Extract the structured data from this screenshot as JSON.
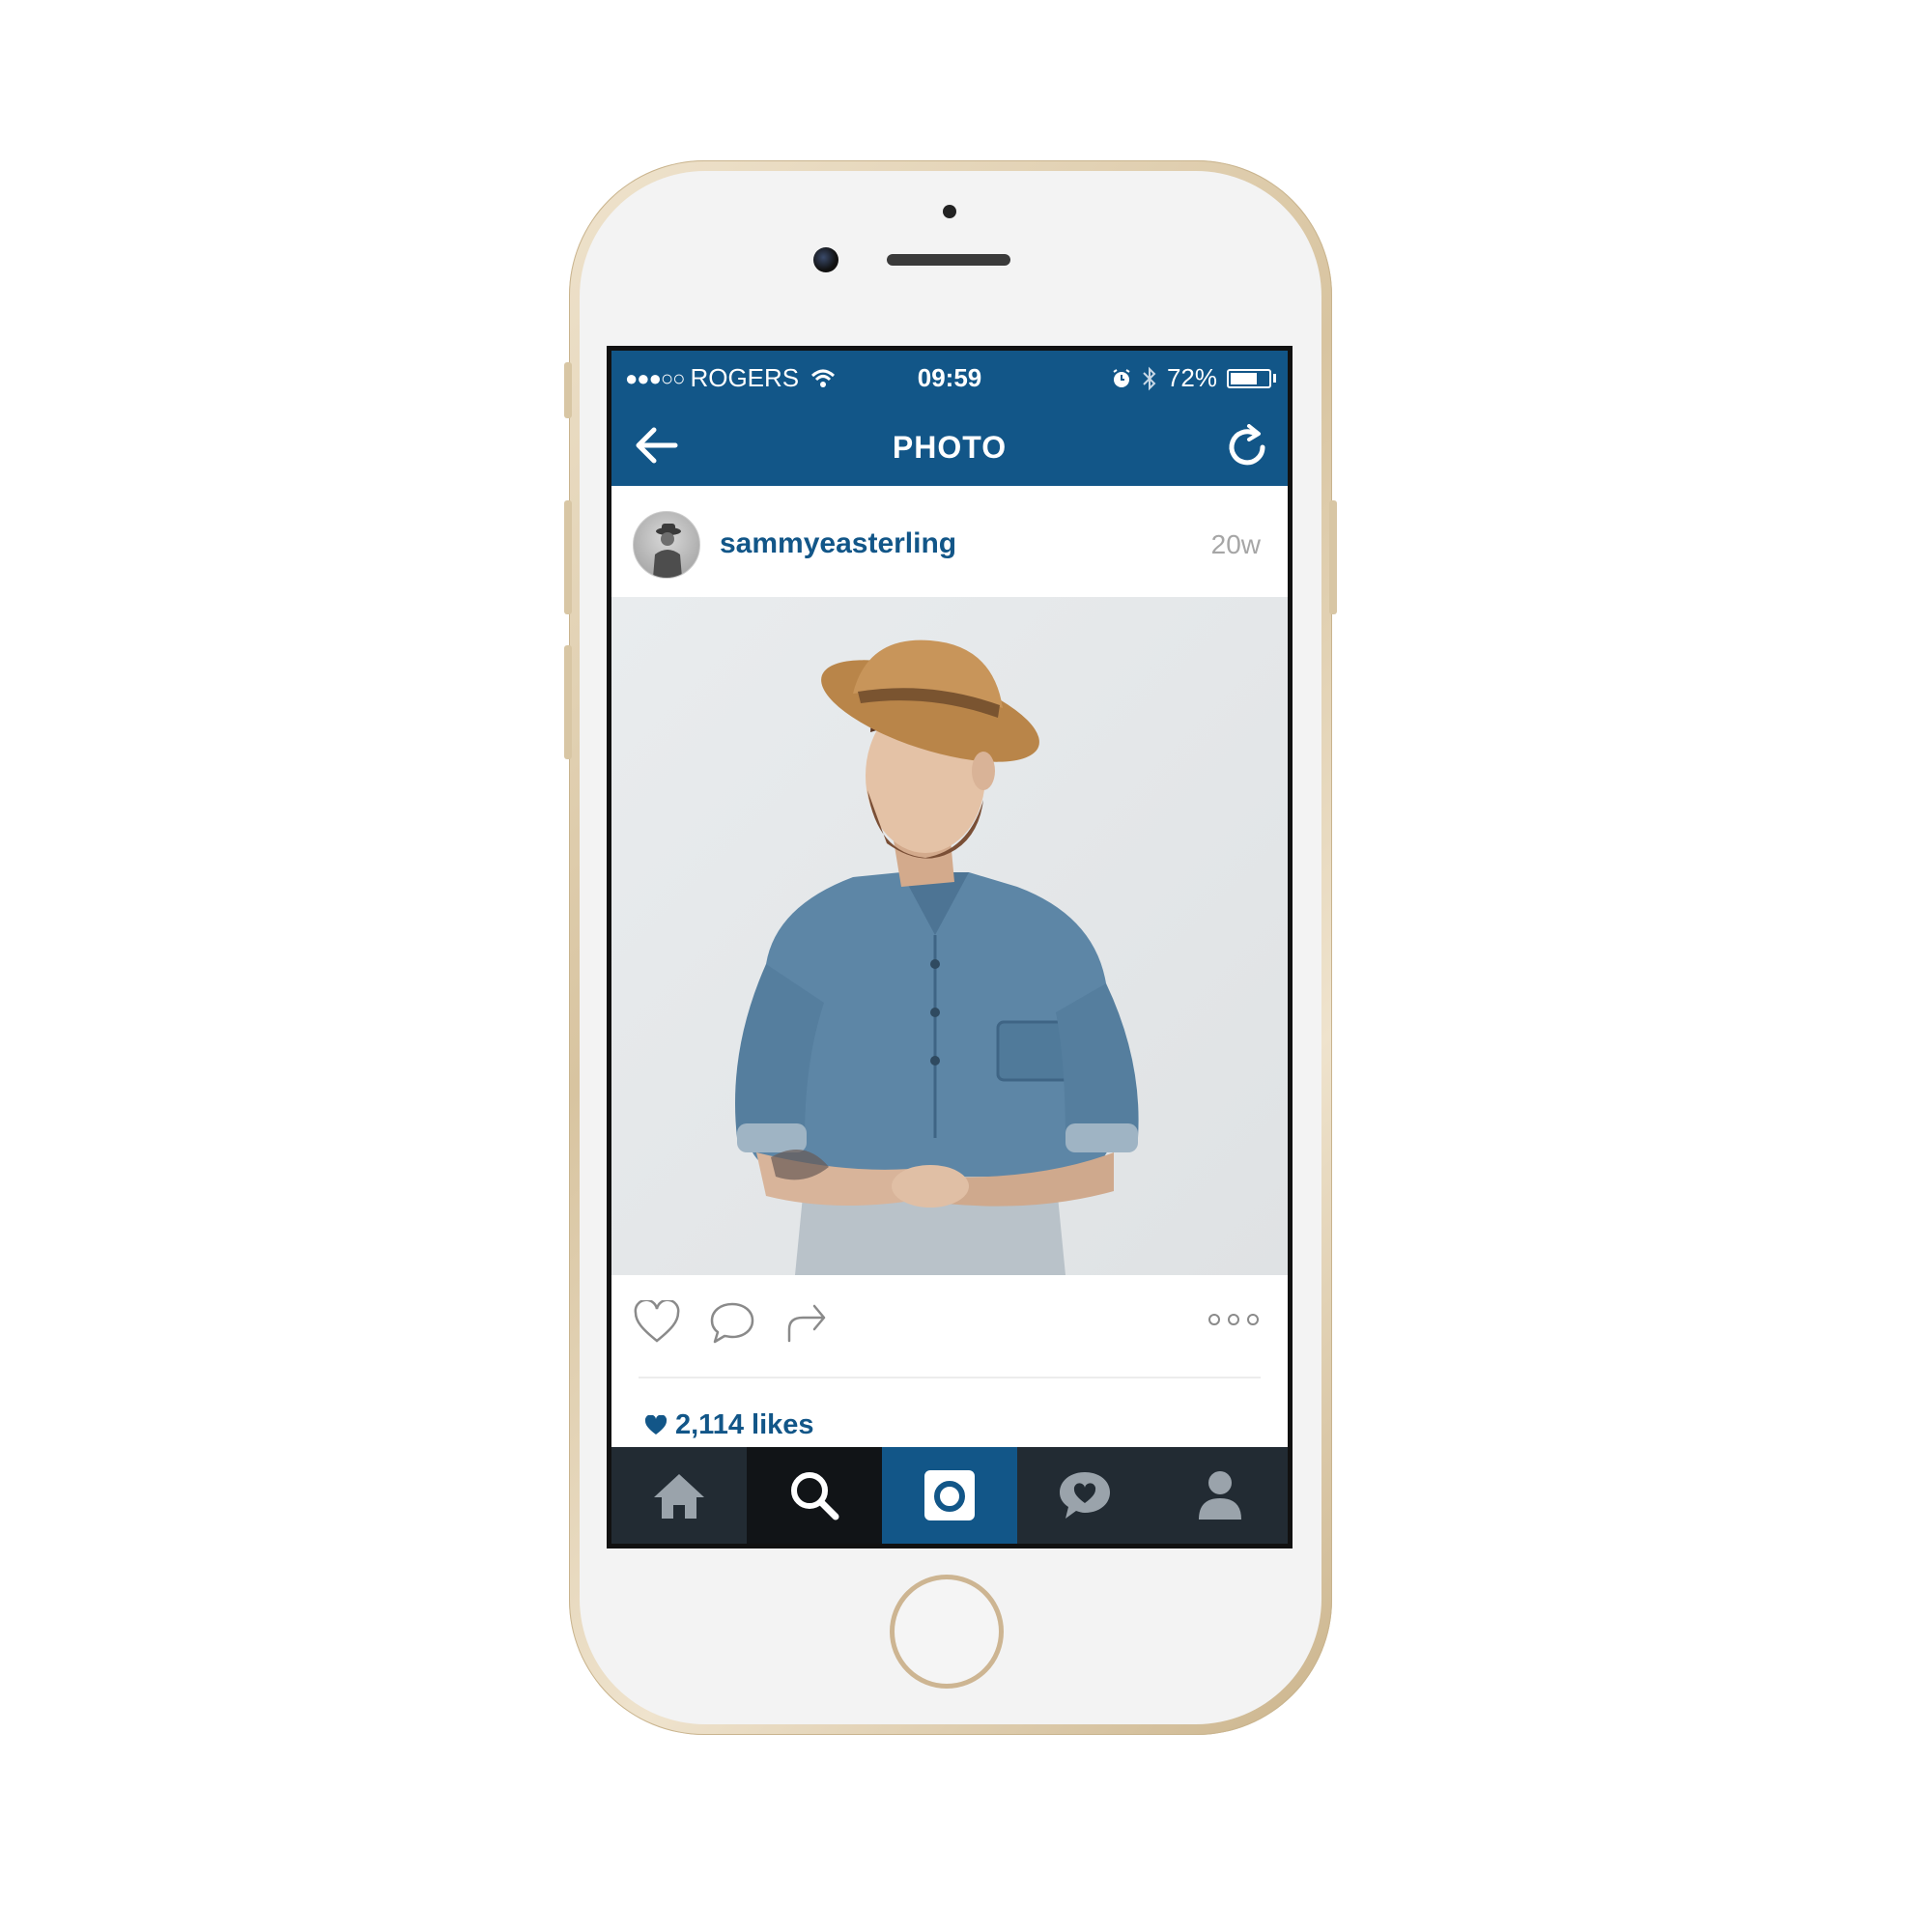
{
  "status_bar": {
    "signal": "●●●○○",
    "carrier": "ROGERS",
    "time": "09:59",
    "battery_text": "72%",
    "battery_level": 0.72
  },
  "nav": {
    "title": "PHOTO",
    "back_icon": "arrow-left-icon",
    "refresh_icon": "refresh-icon"
  },
  "post": {
    "username": "sammyeasterling",
    "age": "20w",
    "likes_text": "2,114 likes"
  },
  "tab_bar": {
    "tabs": [
      {
        "icon": "home-icon"
      },
      {
        "icon": "search-icon",
        "active": true
      },
      {
        "icon": "camera-icon"
      },
      {
        "icon": "activity-icon"
      },
      {
        "icon": "profile-icon"
      }
    ]
  },
  "colors": {
    "brand": "#125688",
    "tab_bar": "#222b33",
    "muted": "#a6a6a6"
  }
}
